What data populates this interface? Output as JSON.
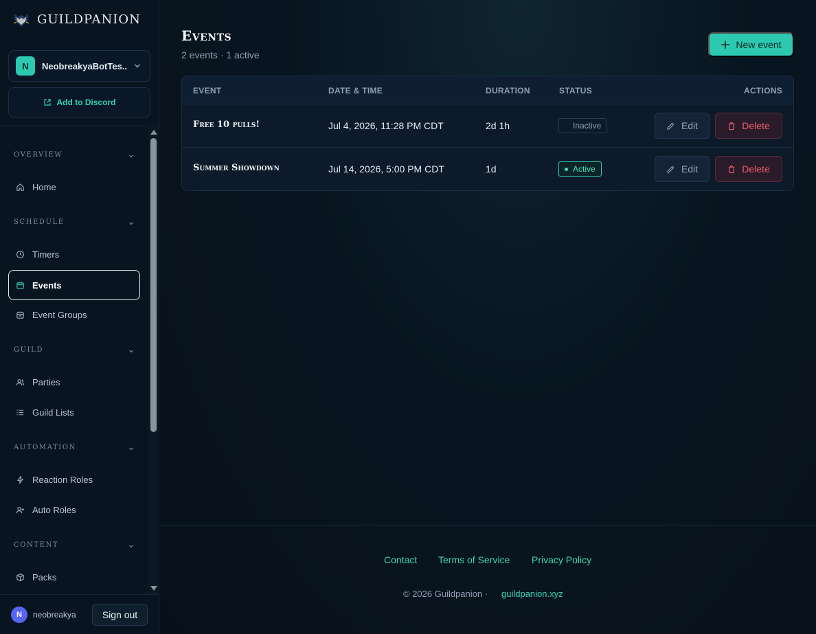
{
  "brand": {
    "name": "GUILDPANION",
    "logo_icon": "guildpanion-wolf-logo"
  },
  "server": {
    "avatar_letter": "N",
    "name": "NeobreakyaBotTes...",
    "accent": "#2cc9b0"
  },
  "add_to_discord": {
    "label": "Add to Discord",
    "icon": "external-link-icon"
  },
  "nav": {
    "sections": [
      {
        "title": "OVERVIEW",
        "items": [
          {
            "label": "Home",
            "icon": "home-icon"
          }
        ]
      },
      {
        "title": "SCHEDULE",
        "items": [
          {
            "label": "Timers",
            "icon": "clock-icon"
          },
          {
            "label": "Events",
            "icon": "calendar-icon",
            "active": true
          },
          {
            "label": "Event Groups",
            "icon": "calendar-group-icon"
          }
        ]
      },
      {
        "title": "GUILD",
        "items": [
          {
            "label": "Parties",
            "icon": "users-icon"
          },
          {
            "label": "Guild Lists",
            "icon": "list-icon"
          }
        ]
      },
      {
        "title": "AUTOMATION",
        "items": [
          {
            "label": "Reaction Roles",
            "icon": "zap-icon"
          },
          {
            "label": "Auto Roles",
            "icon": "user-plus-icon"
          }
        ]
      },
      {
        "title": "CONTENT",
        "items": [
          {
            "label": "Packs",
            "icon": "package-icon"
          }
        ]
      }
    ]
  },
  "user": {
    "avatar_letter": "N",
    "name": "neobreakya",
    "sign_out_label": "Sign out"
  },
  "page": {
    "title": "Events",
    "subtitle": "2 events · 1 active",
    "new_event_label": "New event"
  },
  "table": {
    "columns": [
      "EVENT",
      "DATE & TIME",
      "DURATION",
      "STATUS",
      "ACTIONS"
    ],
    "rows": [
      {
        "event": "Free 10 pulls!",
        "datetime": "Jul 4, 2026, 11:28 PM CDT",
        "duration": "2d 1h",
        "status": "Inactive",
        "edit_label": "Edit",
        "delete_label": "Delete"
      },
      {
        "event": "Summer Showdown",
        "datetime": "Jul 14, 2026, 5:00 PM CDT",
        "duration": "1d",
        "status": "Active",
        "edit_label": "Edit",
        "delete_label": "Delete"
      }
    ]
  },
  "footer": {
    "links": [
      "Contact",
      "Terms of Service",
      "Privacy Policy"
    ],
    "copyright": "© 2026 Guildpanion ·",
    "site": "guildpanion.xyz"
  },
  "colors": {
    "accent": "#2cc9b0",
    "danger": "#ef5b6e",
    "background": "#08121d"
  }
}
